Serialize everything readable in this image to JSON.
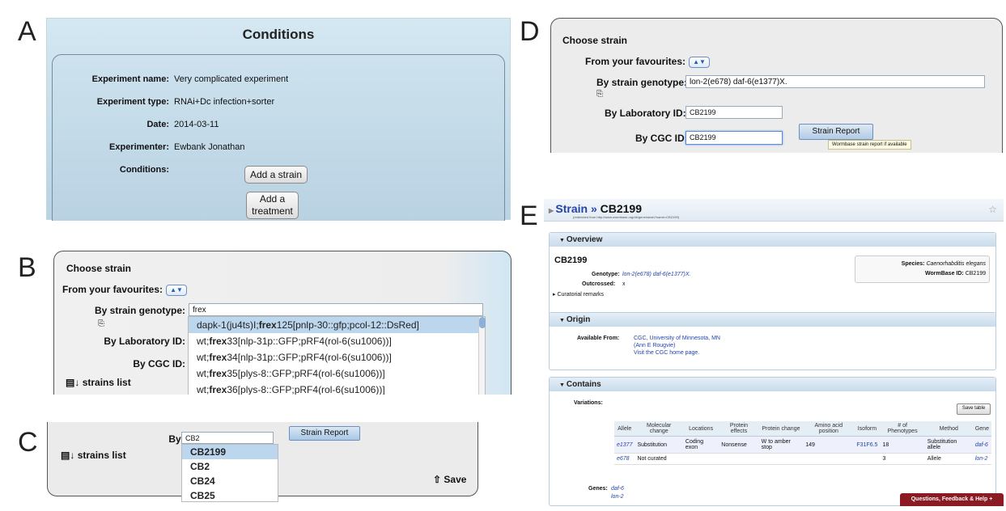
{
  "panel_labels": {
    "a": "A",
    "b": "B",
    "c": "C",
    "d": "D",
    "e": "E"
  },
  "panelA": {
    "title": "Conditions",
    "fields": [
      {
        "label": "Experiment name:",
        "value": "Very complicated experiment"
      },
      {
        "label": "Experiment type:",
        "value": "RNAi+Dc infection+sorter"
      },
      {
        "label": "Date:",
        "value": "2014-03-11"
      },
      {
        "label": "Experimenter:",
        "value": "Ewbank Jonathan"
      },
      {
        "label": "Conditions:",
        "value": ""
      }
    ],
    "add_strain": "Add a strain",
    "add_treatment": "Add a\ntreatment"
  },
  "panelB": {
    "title": "Choose strain",
    "favourites_label": "From your favourites:",
    "genotype_label": "By strain genotype:",
    "genotype_value": "frex",
    "lab_label": "By Laboratory ID:",
    "cgc_label": "By CGC ID:",
    "strains_list": "strains list",
    "suggestions": [
      {
        "pre": "dapk-1(ju4ts)I;",
        "bold": "frex",
        "post": "125[pnlp-30::gfp;pcol-12::DsRed]"
      },
      {
        "pre": "wt;",
        "bold": "frex",
        "post": "33[nlp-31p::GFP;pRF4(rol-6(su1006))]"
      },
      {
        "pre": "wt;",
        "bold": "frex",
        "post": "34[nlp-31p::GFP;pRF4(rol-6(su1006))]"
      },
      {
        "pre": "wt;",
        "bold": "frex",
        "post": "35[plys-8::GFP;pRF4(rol-6(su1006))]"
      },
      {
        "pre": "wt;",
        "bold": "frex",
        "post": "36[plys-8::GFP;pRF4(rol-6(su1006))]"
      }
    ]
  },
  "panelC": {
    "cgc_label": "By CGC ID:",
    "cgc_value": "CB2",
    "strain_report": "Strain Report",
    "strains_list": "strains list",
    "save": "Save",
    "suggestions": [
      "CB2199",
      "CB2",
      "CB24",
      "CB25"
    ]
  },
  "panelD": {
    "title": "Choose strain",
    "favourites_label": "From your favourites:",
    "genotype_label": "By strain genotype:",
    "genotype_value": "lon-2(e678) daf-6(e1377)X.",
    "lab_label": "By Laboratory ID:",
    "lab_value": "CB2199",
    "cgc_label": "By CGC ID:",
    "cgc_value": "CB2199",
    "strain_report": "Strain Report",
    "tooltip": "Wormbase strain report if available"
  },
  "panelE": {
    "crumb": "Strain",
    "sep": "»",
    "strain": "CB2199",
    "redirect": "(redirected from http://www.wormbase.org/db/gene/strain?name=CB2199)",
    "overview": {
      "head": "Overview",
      "name": "CB2199",
      "genotype_label": "Genotype:",
      "genotype": "lon-2(e678) daf-6(e1377)X.",
      "outcrossed_label": "Outcrossed:",
      "outcrossed": "x",
      "curatorial": "Curatorial remarks",
      "species_label": "Species:",
      "species": "Caenorhabditis elegans",
      "wbid_label": "WormBase ID:",
      "wbid": "CB2199"
    },
    "origin": {
      "head": "Origin",
      "label": "Available From:",
      "line1": "CGC, University of Minnesota, MN",
      "line2": "(Ann E Rougvie)",
      "line3": "Visit the CGC home page."
    },
    "contains": {
      "head": "Contains",
      "variations_label": "Variations:",
      "save_table": "Save table",
      "columns": [
        "Allele",
        "Molecular change",
        "Locations",
        "Protein effects",
        "Protein change",
        "Amino acid position",
        "Isoform",
        "# of Phenotypes",
        "Method",
        "Gene"
      ],
      "rows": [
        [
          "e1377",
          "Substitution",
          "Coding exon",
          "Nonsense",
          "W to amber stop",
          "149",
          "F31F6.5",
          "18",
          "Substitution allele",
          "daf-6"
        ],
        [
          "e678",
          "Not curated",
          "",
          "",
          "",
          "",
          "",
          "3",
          "Allele",
          "lon-2"
        ]
      ],
      "genes_label": "Genes:",
      "genes": [
        "daf-6",
        "lon-2"
      ]
    },
    "feedback": "Questions, Feedback & Help +"
  }
}
